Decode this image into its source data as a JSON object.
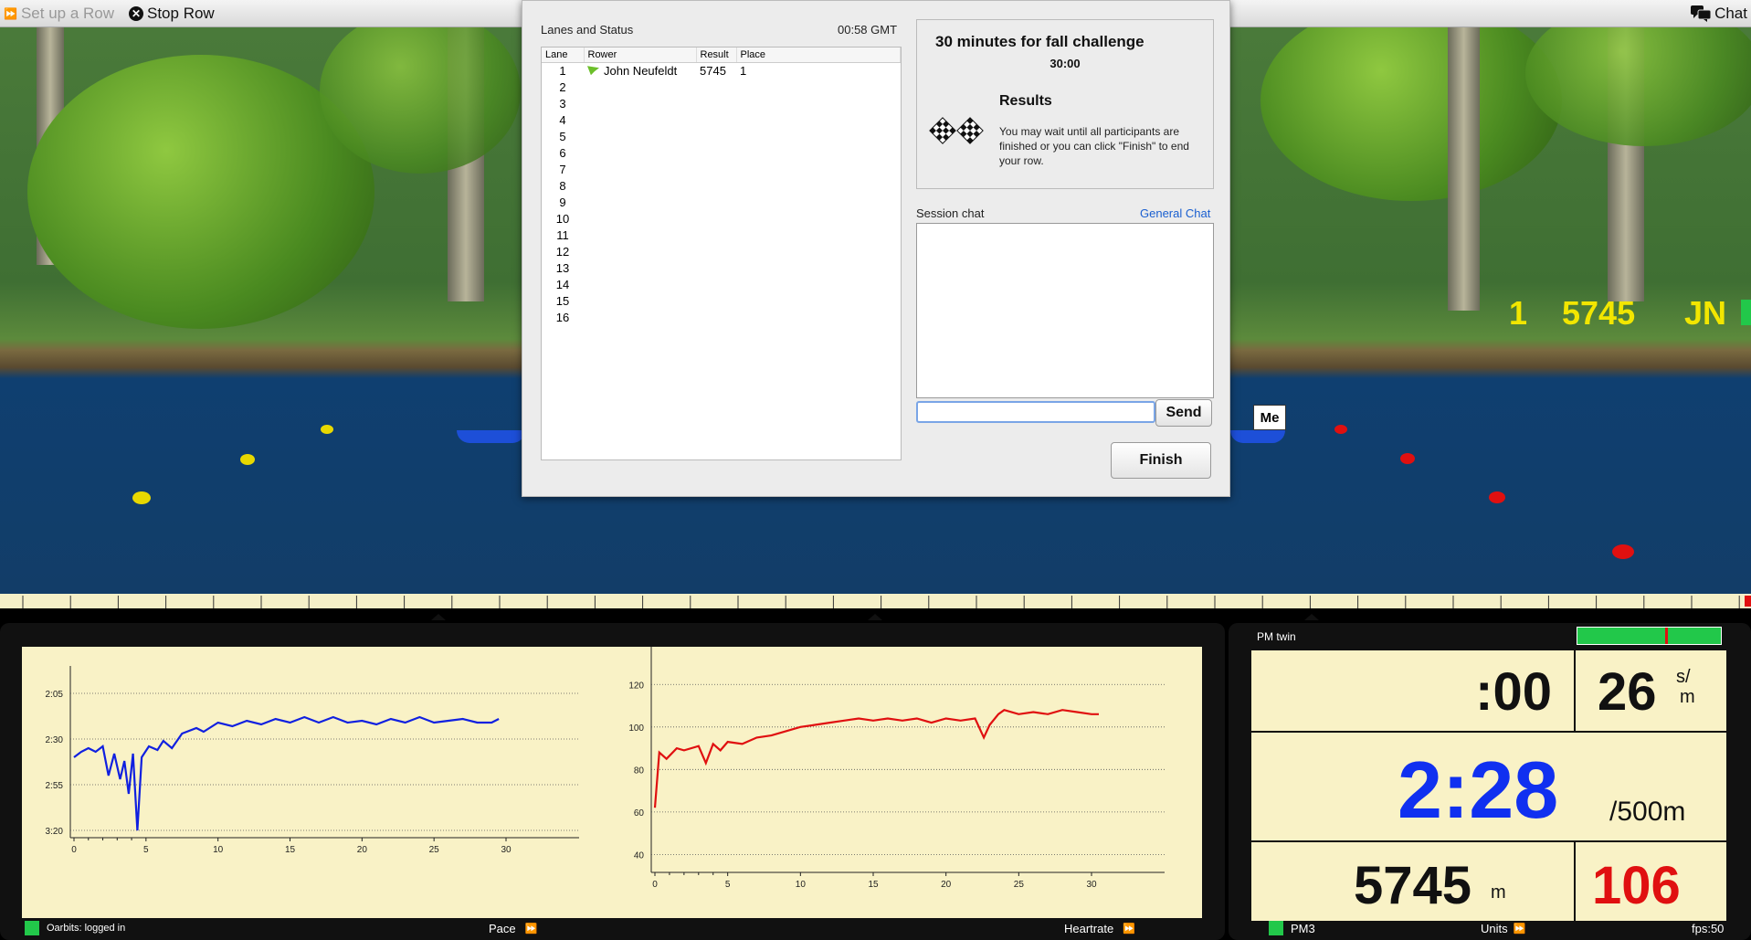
{
  "topbar": {
    "setup_label": "Set up a Row",
    "stop_label": "Stop Row",
    "chat_label": "Chat"
  },
  "scene": {
    "lane_readout": {
      "place": "1",
      "distance": "5745",
      "initials": "JN"
    },
    "me_tag": "Me"
  },
  "dialog": {
    "lanes_title": "Lanes and Status",
    "time": "00:58 GMT",
    "columns": [
      "Lane",
      "Rower",
      "Result",
      "Place"
    ],
    "lanes": [
      {
        "lane": "1",
        "rower": "John Neufeldt",
        "result": "5745",
        "place": "1"
      },
      {
        "lane": "2",
        "rower": "",
        "result": "",
        "place": ""
      },
      {
        "lane": "3",
        "rower": "",
        "result": "",
        "place": ""
      },
      {
        "lane": "4",
        "rower": "",
        "result": "",
        "place": ""
      },
      {
        "lane": "5",
        "rower": "",
        "result": "",
        "place": ""
      },
      {
        "lane": "6",
        "rower": "",
        "result": "",
        "place": ""
      },
      {
        "lane": "7",
        "rower": "",
        "result": "",
        "place": ""
      },
      {
        "lane": "8",
        "rower": "",
        "result": "",
        "place": ""
      },
      {
        "lane": "9",
        "rower": "",
        "result": "",
        "place": ""
      },
      {
        "lane": "10",
        "rower": "",
        "result": "",
        "place": ""
      },
      {
        "lane": "11",
        "rower": "",
        "result": "",
        "place": ""
      },
      {
        "lane": "12",
        "rower": "",
        "result": "",
        "place": ""
      },
      {
        "lane": "13",
        "rower": "",
        "result": "",
        "place": ""
      },
      {
        "lane": "14",
        "rower": "",
        "result": "",
        "place": ""
      },
      {
        "lane": "15",
        "rower": "",
        "result": "",
        "place": ""
      },
      {
        "lane": "16",
        "rower": "",
        "result": "",
        "place": ""
      }
    ],
    "challenge_title": "30 minutes for fall challenge",
    "challenge_time": "30:00",
    "results_heading": "Results",
    "results_text": "You may wait until all participants are finished or you can click \"Finish\" to end your row.",
    "session_chat_label": "Session chat",
    "general_chat_link": "General Chat",
    "chat_input_value": "",
    "send_label": "Send",
    "finish_label": "Finish"
  },
  "charts_panel": {
    "status": "Oarbits: logged in",
    "pace_label": "Pace",
    "heartrate_label": "Heartrate"
  },
  "chart_data": [
    {
      "type": "line",
      "name": "Pace",
      "title": "",
      "xlabel": "",
      "ylabel": "",
      "x_ticks": [
        0,
        5,
        10,
        15,
        20,
        25,
        30
      ],
      "y_ticks": [
        "2:05",
        "2:30",
        "2:55",
        "3:20"
      ],
      "y_reversed": true,
      "ylim_seconds": [
        125,
        200
      ],
      "xlim": [
        0,
        30
      ],
      "color": "#1020e0",
      "points": [
        [
          0,
          160
        ],
        [
          0.5,
          157
        ],
        [
          1,
          155
        ],
        [
          1.5,
          157
        ],
        [
          2,
          154
        ],
        [
          2.4,
          170
        ],
        [
          2.8,
          158
        ],
        [
          3.2,
          172
        ],
        [
          3.5,
          162
        ],
        [
          3.8,
          180
        ],
        [
          4.1,
          158
        ],
        [
          4.4,
          200
        ],
        [
          4.7,
          160
        ],
        [
          5.2,
          154
        ],
        [
          5.8,
          156
        ],
        [
          6.2,
          151
        ],
        [
          6.8,
          155
        ],
        [
          7.5,
          147
        ],
        [
          8.5,
          144
        ],
        [
          9,
          146
        ],
        [
          10,
          141
        ],
        [
          11,
          143
        ],
        [
          12,
          140
        ],
        [
          13,
          142
        ],
        [
          14,
          139
        ],
        [
          15,
          141
        ],
        [
          16,
          138
        ],
        [
          17,
          141
        ],
        [
          18,
          138
        ],
        [
          19,
          141
        ],
        [
          20,
          140
        ],
        [
          21,
          142
        ],
        [
          22,
          139
        ],
        [
          23,
          141
        ],
        [
          24,
          138
        ],
        [
          25,
          141
        ],
        [
          26,
          140
        ],
        [
          27,
          139
        ],
        [
          28,
          141
        ],
        [
          29,
          141
        ],
        [
          29.5,
          139
        ]
      ]
    },
    {
      "type": "line",
      "name": "Heartrate",
      "title": "",
      "xlabel": "",
      "ylabel": "",
      "x_ticks": [
        0,
        5,
        10,
        15,
        20,
        25,
        30
      ],
      "y_ticks": [
        40,
        60,
        80,
        100,
        120
      ],
      "ylim": [
        35,
        130
      ],
      "xlim": [
        0,
        30
      ],
      "color": "#e01010",
      "points": [
        [
          0,
          62
        ],
        [
          0.3,
          88
        ],
        [
          0.8,
          85
        ],
        [
          1.5,
          90
        ],
        [
          2,
          89
        ],
        [
          3,
          91
        ],
        [
          3.5,
          83
        ],
        [
          4,
          92
        ],
        [
          4.5,
          89
        ],
        [
          5,
          93
        ],
        [
          6,
          92
        ],
        [
          7,
          95
        ],
        [
          8,
          96
        ],
        [
          9,
          98
        ],
        [
          10,
          100
        ],
        [
          11,
          101
        ],
        [
          12,
          102
        ],
        [
          13,
          103
        ],
        [
          14,
          104
        ],
        [
          15,
          103
        ],
        [
          16,
          104
        ],
        [
          17,
          103
        ],
        [
          18,
          104
        ],
        [
          19,
          102
        ],
        [
          20,
          104
        ],
        [
          21,
          103
        ],
        [
          22,
          104
        ],
        [
          22.6,
          95
        ],
        [
          23,
          101
        ],
        [
          23.6,
          106
        ],
        [
          24,
          108
        ],
        [
          25,
          106
        ],
        [
          26,
          107
        ],
        [
          27,
          106
        ],
        [
          28,
          108
        ],
        [
          29,
          107
        ],
        [
          30,
          106
        ],
        [
          30.5,
          106
        ]
      ]
    }
  ],
  "pm": {
    "title": "PM twin",
    "elapsed": ":00",
    "stroke_rate": "26",
    "stroke_unit_top": "s/",
    "stroke_unit_bottom": "m",
    "pace": "2:28",
    "pace_unit": "/500m",
    "distance": "5745",
    "distance_unit": "m",
    "heart_rate": "106",
    "connection_label": "PM3",
    "units_label": "Units",
    "fps_label": "fps:50",
    "status_color": "#22c84a",
    "heart_color": "#e01010",
    "pace_color": "#1030f0"
  }
}
